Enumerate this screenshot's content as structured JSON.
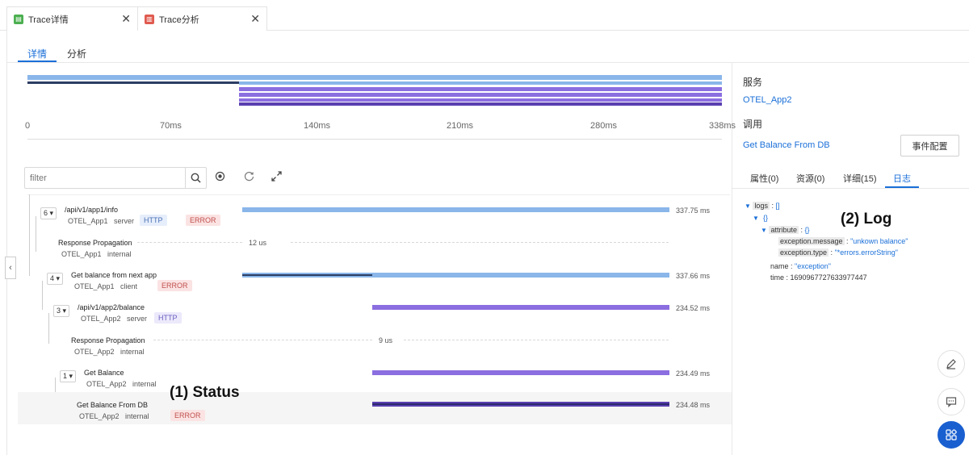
{
  "tabs": [
    {
      "label": "Trace详情",
      "icon": "table-icon",
      "color": "#4caf50"
    },
    {
      "label": "Trace分析",
      "icon": "report-icon",
      "color": "#e05a4f"
    }
  ],
  "subtabs": [
    "详情",
    "分析"
  ],
  "timeline": {
    "ticks": [
      "0",
      "70ms",
      "140ms",
      "210ms",
      "280ms",
      "338ms"
    ]
  },
  "filter": {
    "placeholder": "filter"
  },
  "spans": [
    {
      "count": "6",
      "name": "/api/v1/app1/info",
      "service": "OTEL_App1",
      "kind": "server",
      "tag": "HTTP",
      "status": "ERROR",
      "duration": "337.75 ms"
    },
    {
      "name": "Response Propagation",
      "service": "OTEL_App1",
      "kind": "internal",
      "duration": "12 us"
    },
    {
      "count": "4",
      "name": "Get balance from next app",
      "service": "OTEL_App1",
      "kind": "client",
      "status": "ERROR",
      "duration": "337.66 ms"
    },
    {
      "count": "3",
      "name": "/api/v1/app2/balance",
      "service": "OTEL_App2",
      "kind": "server",
      "tag": "HTTP",
      "duration": "234.52 ms"
    },
    {
      "name": "Response Propagation",
      "service": "OTEL_App2",
      "kind": "internal",
      "duration": "9 us"
    },
    {
      "count": "1",
      "name": "Get Balance",
      "service": "OTEL_App2",
      "kind": "internal",
      "duration": "234.49 ms"
    },
    {
      "name": "Get Balance From DB",
      "service": "OTEL_App2",
      "kind": "internal",
      "status": "ERROR",
      "duration": "234.48 ms"
    }
  ],
  "right": {
    "service_label": "服务",
    "service_value": "OTEL_App2",
    "call_label": "调用",
    "call_value": "Get Balance From DB",
    "event_button": "事件配置",
    "tabs": [
      "属性(0)",
      "资源(0)",
      "详细(15)",
      "日志"
    ],
    "log": {
      "logs_key": "logs",
      "logs_val": "[]",
      "obj_val": "{}",
      "attr_key": "attribute",
      "attr_val": "{}",
      "msg_key": "exception.message",
      "msg_val": "\"unkown balance\"",
      "type_key": "exception.type",
      "type_val": "\"*errors.errorString\"",
      "name_key": "name",
      "name_val": "\"exception\"",
      "time_key": "time",
      "time_val": "1690967727633977447"
    }
  },
  "annotations": {
    "status": "(1) Status",
    "log": "(2) Log"
  },
  "colors": {
    "accent": "#1a6fd8",
    "light_blue": "#8ab6ea",
    "purple": "#8b6ee0",
    "dark_purple": "#5a3fb0",
    "error": "#c0504d"
  }
}
